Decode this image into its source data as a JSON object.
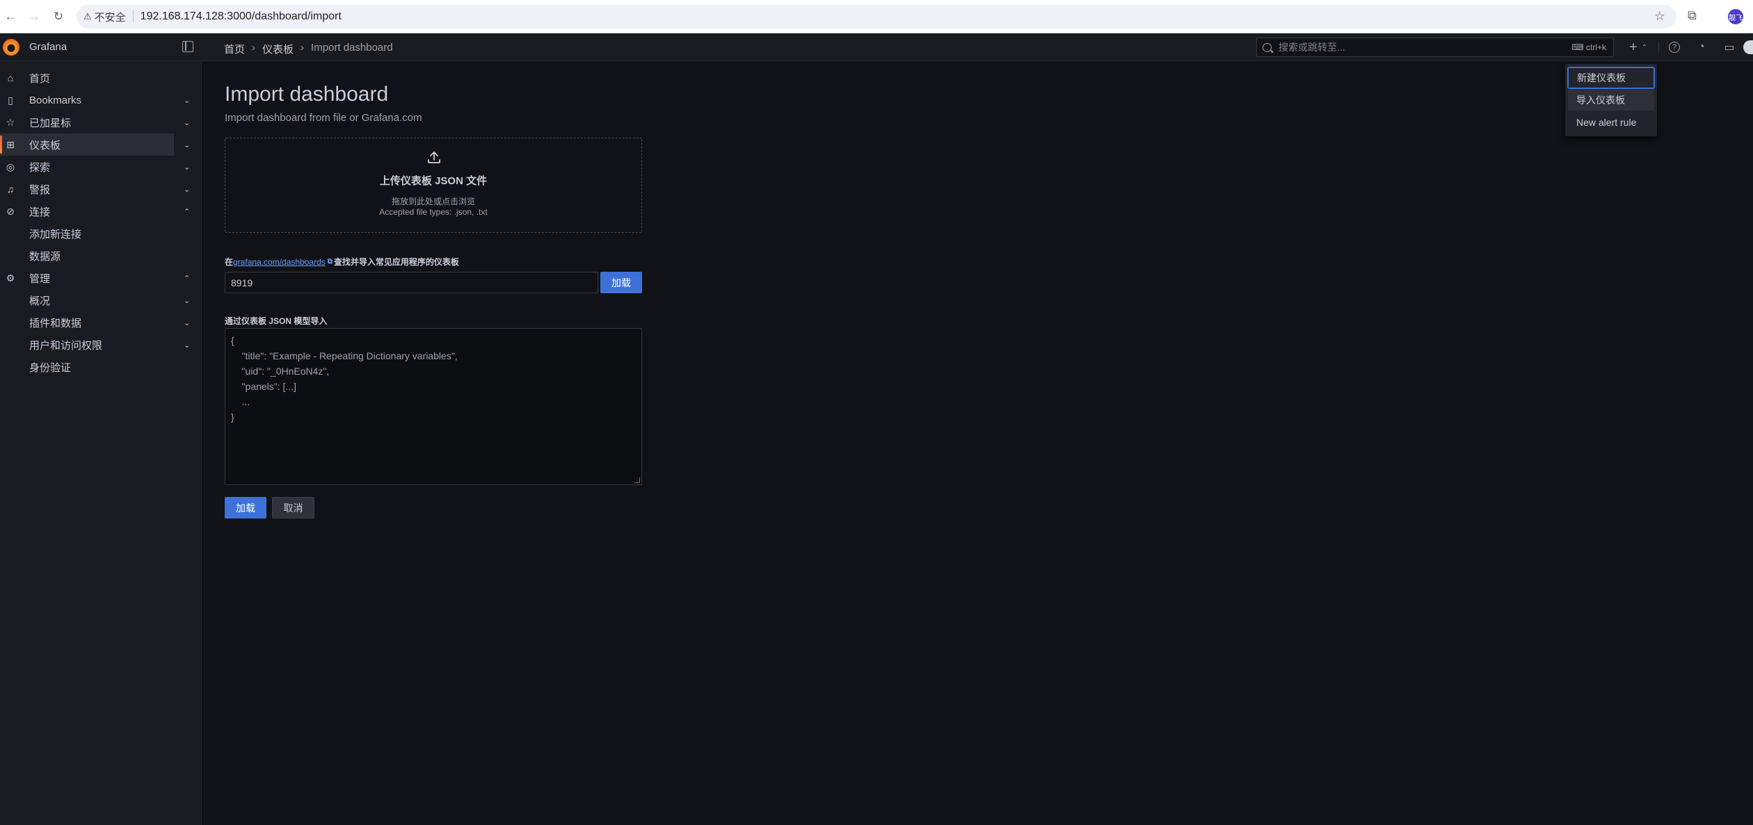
{
  "browser": {
    "security_label": "不安全",
    "url": "192.168.174.128:3000/dashboard/import",
    "profile_initials": "靓飞"
  },
  "topbar": {
    "brand": "Grafana",
    "breadcrumbs": [
      "首页",
      "仪表板",
      "Import dashboard"
    ],
    "search_placeholder": "搜索或跳转至...",
    "search_shortcut": "ctrl+k"
  },
  "sidebar": {
    "items": [
      {
        "label": "首页",
        "icon": "home-icon",
        "chevron": ""
      },
      {
        "label": "Bookmarks",
        "icon": "bookmark-icon",
        "chevron": "down"
      },
      {
        "label": "已加星标",
        "icon": "star-icon",
        "chevron": "down"
      },
      {
        "label": "仪表板",
        "icon": "apps-icon",
        "chevron": "down",
        "active": true
      },
      {
        "label": "探索",
        "icon": "compass-icon",
        "chevron": "down"
      },
      {
        "label": "警报",
        "icon": "bell-icon",
        "chevron": "down"
      },
      {
        "label": "连接",
        "icon": "link-icon",
        "chevron": "up"
      },
      {
        "label": "添加新连接",
        "icon": "",
        "chevron": "",
        "sub": true
      },
      {
        "label": "数据源",
        "icon": "",
        "chevron": "",
        "sub": true
      },
      {
        "label": "管理",
        "icon": "gear-icon",
        "chevron": "up"
      },
      {
        "label": "概况",
        "icon": "",
        "chevron": "down",
        "sub": true
      },
      {
        "label": "插件和数据",
        "icon": "",
        "chevron": "down",
        "sub": true
      },
      {
        "label": "用户和访问权限",
        "icon": "",
        "chevron": "down",
        "sub": true
      },
      {
        "label": "身份验证",
        "icon": "",
        "chevron": "",
        "sub": true
      }
    ]
  },
  "main": {
    "title": "Import dashboard",
    "subtitle": "Import dashboard from file or Grafana.com",
    "upload": {
      "title": "上传仪表板 JSON 文件",
      "hint": "拖放到此处或点击浏览",
      "accepted": "Accepted file types: .json, .txt"
    },
    "grafana_com": {
      "prefix": "在",
      "link": "grafana.com/dashboards",
      "suffix": "查找并导入常见应用程序的仪表板",
      "value": "8919",
      "load_label": "加载"
    },
    "json_model": {
      "label": "通过仪表板 JSON 模型导入",
      "placeholder": "{\n    \"title\": \"Example - Repeating Dictionary variables\",\n    \"uid\": \"_0HnEoN4z\",\n    \"panels\": [...]\n    ...\n}"
    },
    "actions": {
      "load_label": "加载",
      "cancel_label": "取消"
    }
  },
  "new_menu": {
    "items": [
      "新建仪表板",
      "导入仪表板",
      "New alert rule"
    ]
  },
  "colors": {
    "accent": "#3d71d9",
    "background": "#111217",
    "panel": "#181b1f"
  }
}
